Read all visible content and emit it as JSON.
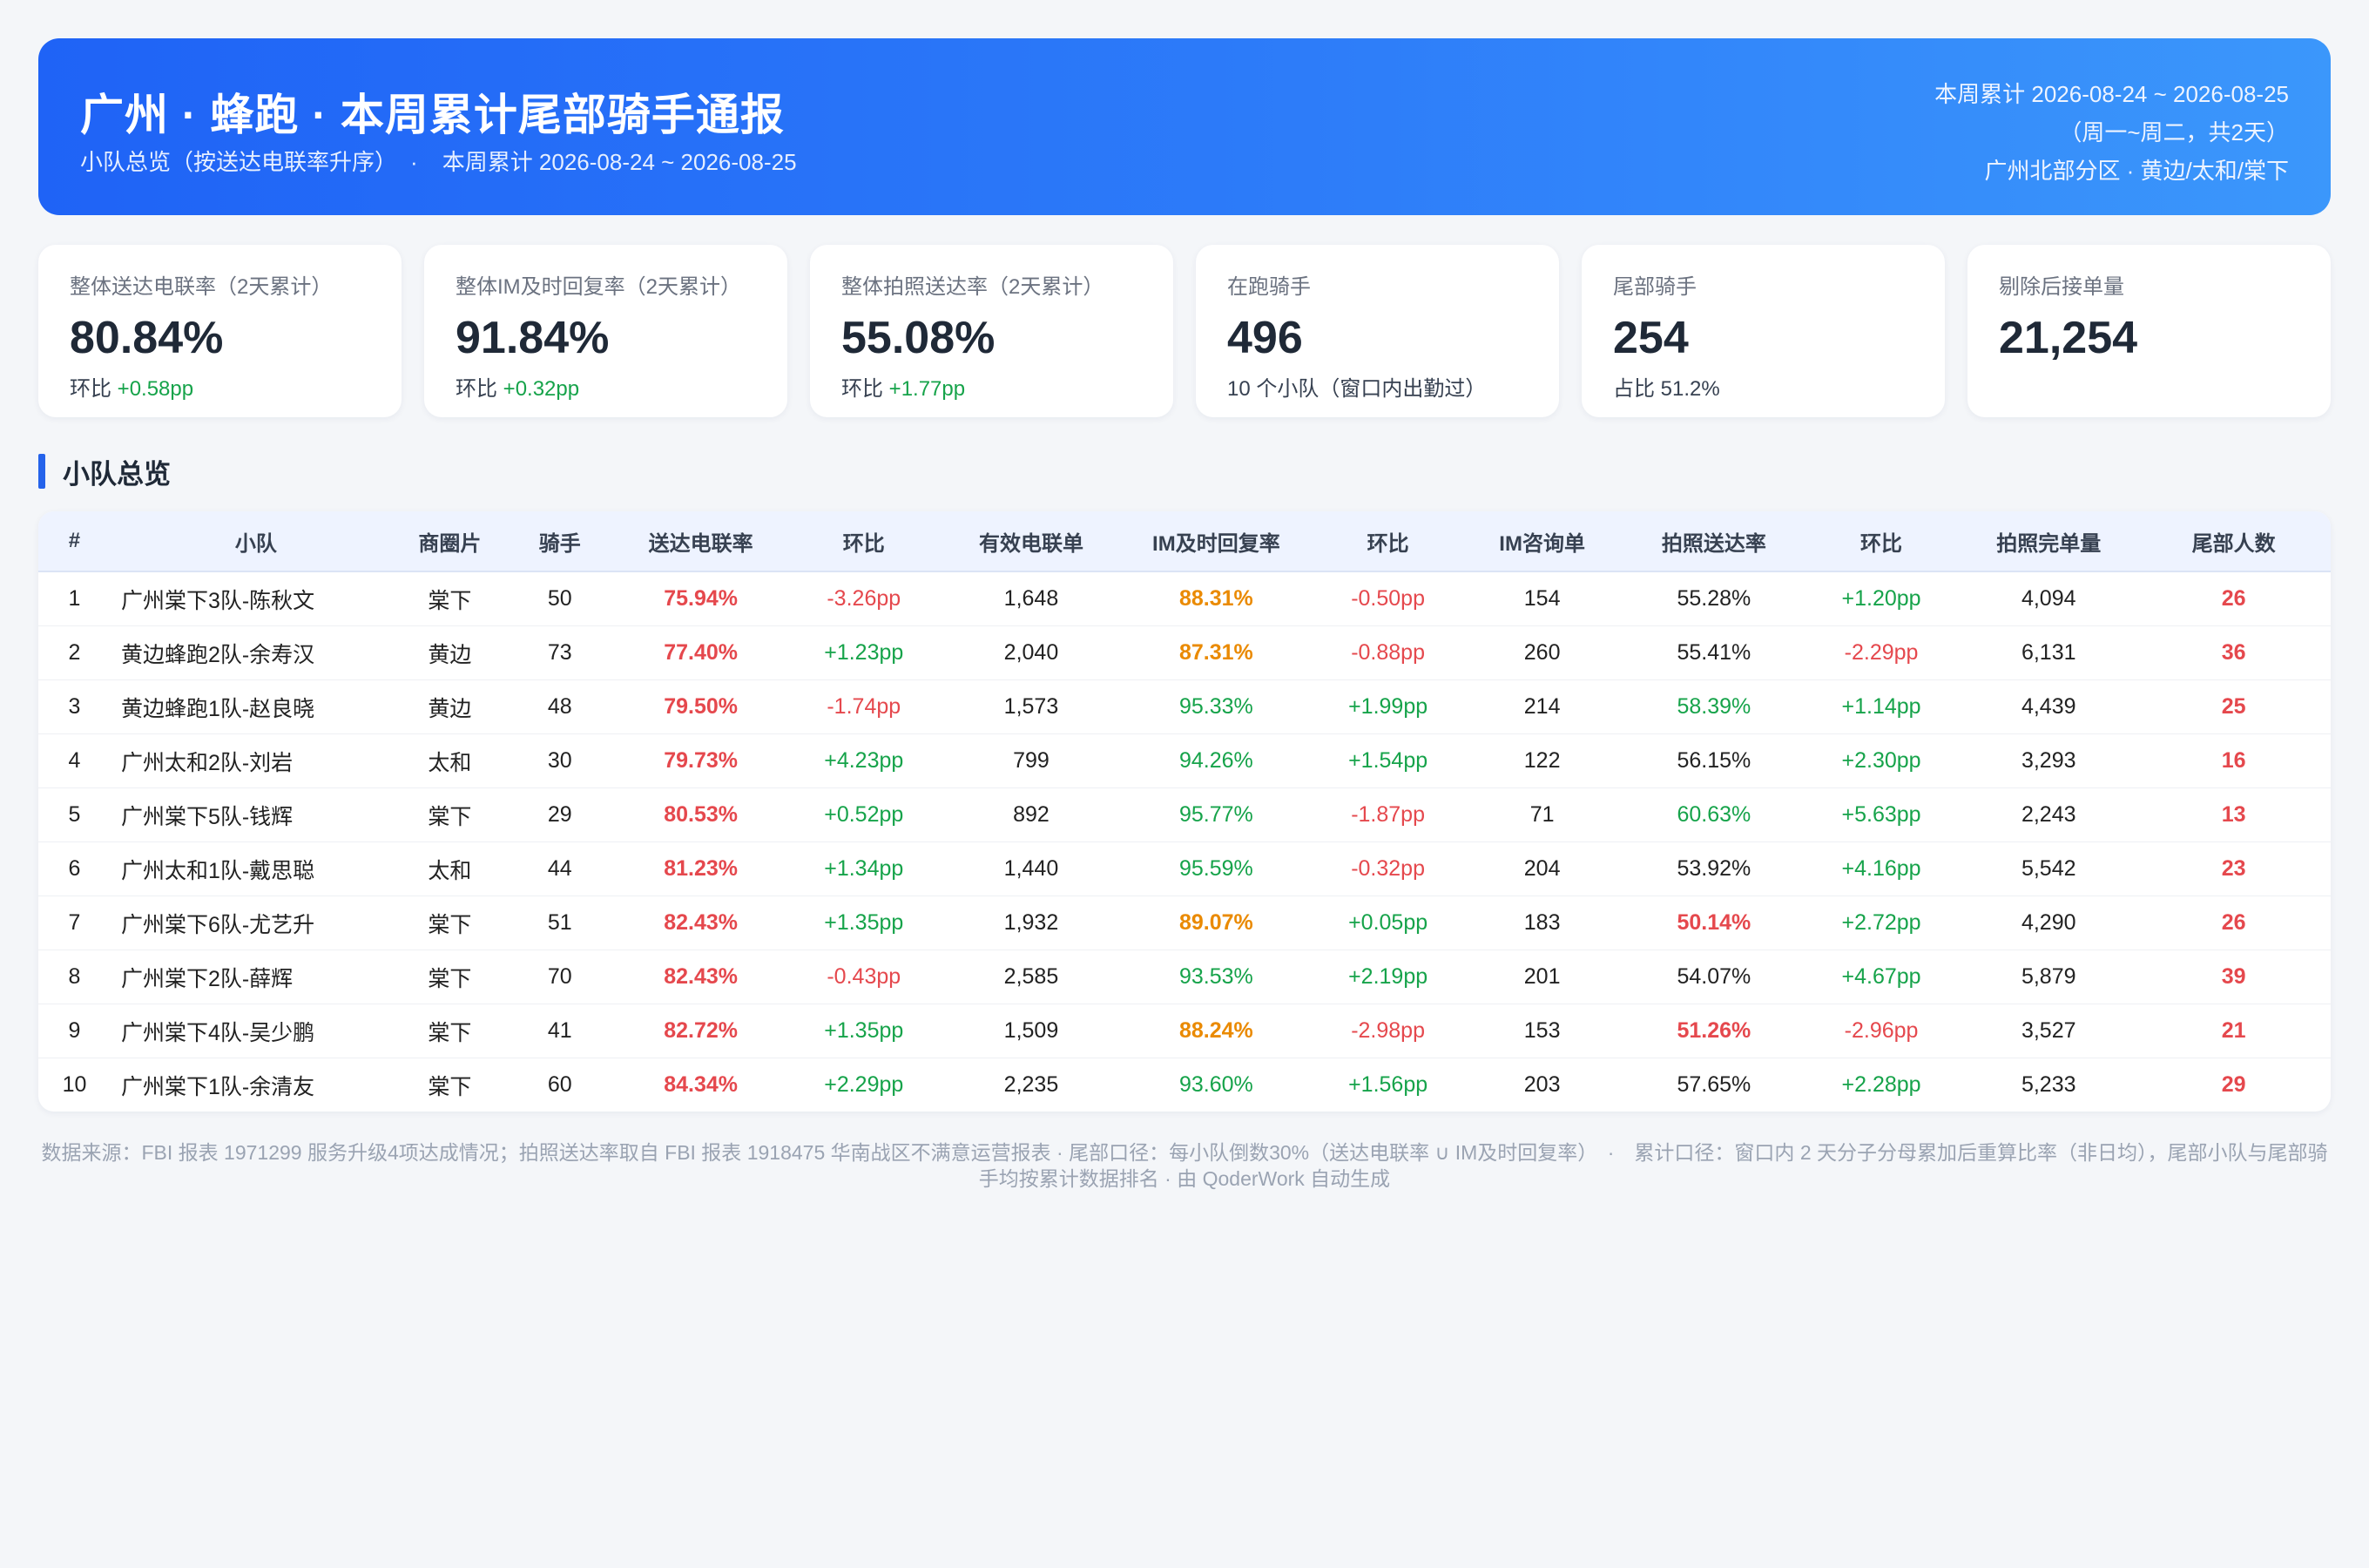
{
  "header": {
    "title": "广州 · 蜂跑 · 本周累计尾部骑手通报",
    "subtitle_left": "小队总览（按送达电联率升序）",
    "subtitle_dot": "·",
    "subtitle_right": "本周累计 2026-08-24 ~ 2026-08-25",
    "right_line1": "本周累计 2026-08-24 ~ 2026-08-25",
    "right_line2": "（周一~周二，共2天）",
    "right_line3": "广州北部分区 · 黄边/太和/棠下"
  },
  "kpis": [
    {
      "label": "整体送达电联率（2天累计）",
      "value": "80.84%",
      "sub_prefix": "环比 ",
      "sub_delta": "+0.58pp"
    },
    {
      "label": "整体IM及时回复率（2天累计）",
      "value": "91.84%",
      "sub_prefix": "环比 ",
      "sub_delta": "+0.32pp"
    },
    {
      "label": "整体拍照送达率（2天累计）",
      "value": "55.08%",
      "sub_prefix": "环比 ",
      "sub_delta": "+1.77pp"
    },
    {
      "label": "在跑骑手",
      "value": "496",
      "sub_prefix": "10 个小队（窗口内出勤过）",
      "sub_delta": ""
    },
    {
      "label": "尾部骑手",
      "value": "254",
      "sub_prefix": "占比 51.2%",
      "sub_delta": ""
    },
    {
      "label": "剔除后接单量",
      "value": "21,254",
      "sub_prefix": "",
      "sub_delta": ""
    }
  ],
  "section_title": "小队总览",
  "table": {
    "headers": [
      "#",
      "小队",
      "商圈片",
      "骑手",
      "送达电联率",
      "环比",
      "有效电联单",
      "IM及时回复率",
      "环比",
      "IM咨询单",
      "拍照送达率",
      "环比",
      "拍照完单量",
      "尾部人数"
    ],
    "rows": [
      [
        "1",
        "广州棠下3队-陈秋文",
        "棠下",
        "50",
        "75.94%",
        "-3.26pp",
        "1,648",
        "88.31%",
        "-0.50pp",
        "154",
        "55.28%",
        "+1.20pp",
        "4,094",
        "26"
      ],
      [
        "2",
        "黄边蜂跑2队-余寿汉",
        "黄边",
        "73",
        "77.40%",
        "+1.23pp",
        "2,040",
        "87.31%",
        "-0.88pp",
        "260",
        "55.41%",
        "-2.29pp",
        "6,131",
        "36"
      ],
      [
        "3",
        "黄边蜂跑1队-赵良晓",
        "黄边",
        "48",
        "79.50%",
        "-1.74pp",
        "1,573",
        "95.33%",
        "+1.99pp",
        "214",
        "58.39%",
        "+1.14pp",
        "4,439",
        "25"
      ],
      [
        "4",
        "广州太和2队-刘岩",
        "太和",
        "30",
        "79.73%",
        "+4.23pp",
        "799",
        "94.26%",
        "+1.54pp",
        "122",
        "56.15%",
        "+2.30pp",
        "3,293",
        "16"
      ],
      [
        "5",
        "广州棠下5队-钱辉",
        "棠下",
        "29",
        "80.53%",
        "+0.52pp",
        "892",
        "95.77%",
        "-1.87pp",
        "71",
        "60.63%",
        "+5.63pp",
        "2,243",
        "13"
      ],
      [
        "6",
        "广州太和1队-戴思聪",
        "太和",
        "44",
        "81.23%",
        "+1.34pp",
        "1,440",
        "95.59%",
        "-0.32pp",
        "204",
        "53.92%",
        "+4.16pp",
        "5,542",
        "23"
      ],
      [
        "7",
        "广州棠下6队-尤艺升",
        "棠下",
        "51",
        "82.43%",
        "+1.35pp",
        "1,932",
        "89.07%",
        "+0.05pp",
        "183",
        "50.14%",
        "+2.72pp",
        "4,290",
        "26"
      ],
      [
        "8",
        "广州棠下2队-薛辉",
        "棠下",
        "70",
        "82.43%",
        "-0.43pp",
        "2,585",
        "93.53%",
        "+2.19pp",
        "201",
        "54.07%",
        "+4.67pp",
        "5,879",
        "39"
      ],
      [
        "9",
        "广州棠下4队-吴少鹏",
        "棠下",
        "41",
        "82.72%",
        "+1.35pp",
        "1,509",
        "88.24%",
        "-2.98pp",
        "153",
        "51.26%",
        "-2.96pp",
        "3,527",
        "21"
      ],
      [
        "10",
        "广州棠下1队-余清友",
        "棠下",
        "60",
        "84.34%",
        "+2.29pp",
        "2,235",
        "93.60%",
        "+1.56pp",
        "203",
        "57.65%",
        "+2.28pp",
        "5,233",
        "29"
      ]
    ],
    "styles": [
      [
        "plain",
        "plain",
        "plain",
        "plain",
        "red-b",
        "red",
        "plain",
        "orange-b",
        "red",
        "plain",
        "plain",
        "green",
        "plain",
        "red-b"
      ],
      [
        "plain",
        "plain",
        "plain",
        "plain",
        "red-b",
        "green",
        "plain",
        "orange-b",
        "red",
        "plain",
        "plain",
        "red",
        "plain",
        "red-b"
      ],
      [
        "plain",
        "plain",
        "plain",
        "plain",
        "red-b",
        "red",
        "plain",
        "green",
        "green",
        "plain",
        "green",
        "green",
        "plain",
        "red-b"
      ],
      [
        "plain",
        "plain",
        "plain",
        "plain",
        "red-b",
        "green",
        "plain",
        "green",
        "green",
        "plain",
        "plain",
        "green",
        "plain",
        "red-b"
      ],
      [
        "plain",
        "plain",
        "plain",
        "plain",
        "red-b",
        "green",
        "plain",
        "green",
        "red",
        "plain",
        "green",
        "green",
        "plain",
        "red-b"
      ],
      [
        "plain",
        "plain",
        "plain",
        "plain",
        "red-b",
        "green",
        "plain",
        "green",
        "red",
        "plain",
        "plain",
        "green",
        "plain",
        "red-b"
      ],
      [
        "plain",
        "plain",
        "plain",
        "plain",
        "red-b",
        "green",
        "plain",
        "orange-b",
        "green",
        "plain",
        "red-b",
        "green",
        "plain",
        "red-b"
      ],
      [
        "plain",
        "plain",
        "plain",
        "plain",
        "red-b",
        "red",
        "plain",
        "green",
        "green",
        "plain",
        "plain",
        "green",
        "plain",
        "red-b"
      ],
      [
        "plain",
        "plain",
        "plain",
        "plain",
        "red-b",
        "green",
        "plain",
        "orange-b",
        "red",
        "plain",
        "red-b",
        "red",
        "plain",
        "red-b"
      ],
      [
        "plain",
        "plain",
        "plain",
        "plain",
        "red-b",
        "green",
        "plain",
        "green",
        "green",
        "plain",
        "plain",
        "green",
        "plain",
        "red-b"
      ]
    ]
  },
  "footer": {
    "text": "数据来源：FBI 报表 1971299 服务升级4项达成情况；拍照送达率取自 FBI 报表 1918475 华南战区不满意运营报表 · 尾部口径：每小队倒数30%（送达电联率 ∪ IM及时回复率）　·　累计口径：窗口内 2 天分子分母累加后重算比率（非日均），尾部小队与尾部骑手均按累计数据排名 · 由 QoderWork 自动生成"
  },
  "colors": {
    "banner_start": "#1f63f6",
    "banner_end": "#3b97fb",
    "accent": "#2563eb",
    "negative": "#e5484d",
    "positive": "#16a34a",
    "warning": "#ea8a00"
  }
}
